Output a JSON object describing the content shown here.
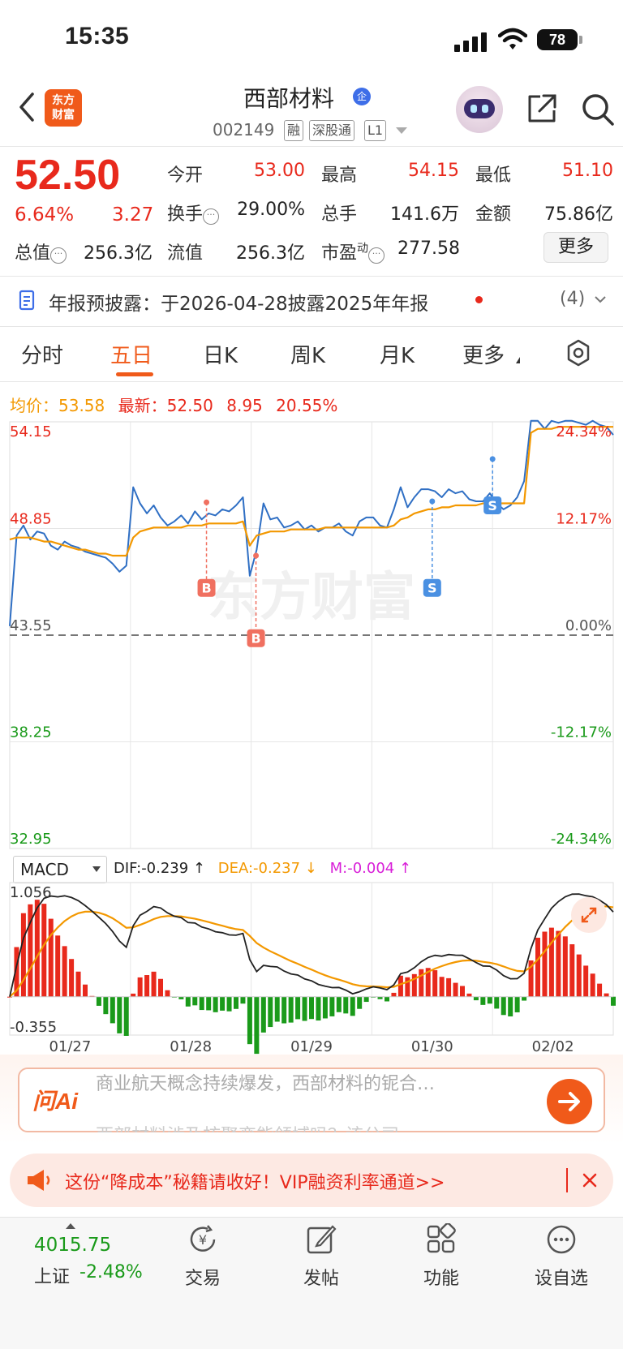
{
  "status_bar": {
    "time": "15:35",
    "battery": "78"
  },
  "header": {
    "logo_line1": "东方",
    "logo_line2": "财富",
    "stock_name": "西部材料",
    "qiye_badge": "企",
    "stock_code": "002149",
    "tags": [
      "融",
      "深股通",
      "L1"
    ]
  },
  "quote": {
    "price": "52.50",
    "pct_change": "6.64%",
    "amt_change": "3.27",
    "fields": [
      {
        "label": "今开",
        "value": "53.00",
        "color": "#e8291c"
      },
      {
        "label": "最高",
        "value": "54.15",
        "color": "#e8291c"
      },
      {
        "label": "最低",
        "value": "51.10",
        "color": "#e8291c"
      },
      {
        "label": "换手",
        "value": "29.00%",
        "color": "#222222"
      },
      {
        "label": "总手",
        "value": "141.6万",
        "color": "#222222"
      },
      {
        "label": "金额",
        "value": "75.86亿",
        "color": "#222222"
      },
      {
        "label": "总值",
        "value": "256.3亿",
        "color": "#222222"
      },
      {
        "label": "流值",
        "value": "256.3亿",
        "color": "#222222"
      },
      {
        "label": "市盈",
        "value": "277.58",
        "color": "#222222"
      }
    ],
    "pe_superscript": "动",
    "more_label": "更多"
  },
  "notice": {
    "text": "年报预披露：于2026-04-28披露2025年年报",
    "count": "(4)"
  },
  "tabs": [
    "分时",
    "五日",
    "日K",
    "周K",
    "月K",
    "更多"
  ],
  "active_tab": "五日",
  "chart_header": {
    "avg_label": "均价：",
    "avg_value": "53.58",
    "latest_label": "最新：",
    "latest_value": "52.50",
    "change": "8.95",
    "change_pct": "20.55%"
  },
  "chart_data": {
    "type": "line",
    "dates": [
      "01/27",
      "01/28",
      "01/29",
      "01/30",
      "02/02"
    ],
    "y_left_ticks": [
      "54.15",
      "48.85",
      "43.55",
      "38.25",
      "32.95"
    ],
    "y_right_ticks": [
      "24.34%",
      "12.17%",
      "0.00%",
      "-12.17%",
      "-24.34%"
    ],
    "ylim": [
      32.95,
      54.15
    ],
    "prev_close": 43.55,
    "watermark": "东方财富",
    "series": [
      {
        "color": "#2f6fc4",
        "values": [
          44.0,
          48.5,
          49.0,
          48.3,
          48.7,
          48.6,
          48.0,
          47.8,
          48.2,
          48.0,
          47.9,
          47.7,
          47.6,
          47.5,
          47.4,
          47.1,
          46.7,
          47.0,
          50.9,
          50.1,
          49.6,
          50.0,
          49.4,
          49.0,
          49.2,
          49.5,
          49.1,
          49.7,
          49.3,
          49.6,
          49.5,
          49.8,
          49.7,
          50.0,
          50.4,
          46.5,
          47.8,
          50.1,
          49.3,
          49.4,
          48.9,
          49.0,
          49.2,
          48.8,
          49.0,
          48.7,
          48.9,
          48.9,
          49.1,
          48.7,
          48.5,
          49.2,
          49.4,
          49.4,
          49.0,
          48.9,
          49.8,
          50.9,
          49.9,
          50.4,
          50.8,
          50.8,
          50.7,
          50.4,
          50.8,
          50.6,
          50.7,
          50.3,
          50.2,
          50.2,
          50.6,
          50.1,
          49.8,
          50.0,
          50.4,
          51.2,
          54.2,
          54.2,
          53.8,
          54.2,
          54.1,
          54.2,
          54.2,
          54.1,
          54.0,
          54.2,
          54.0,
          53.9,
          53.5
        ],
        "name": ""
      },
      {
        "color": "#f39800",
        "values": [
          48.3,
          48.4,
          48.4,
          48.4,
          48.3,
          48.2,
          48.2,
          48.1,
          48.0,
          47.9,
          47.8,
          47.8,
          47.7,
          47.6,
          47.6,
          47.5,
          47.5,
          47.5,
          48.4,
          48.7,
          48.8,
          48.9,
          48.9,
          48.9,
          48.9,
          48.9,
          49.0,
          49.0,
          49.0,
          49.1,
          49.1,
          49.1,
          49.1,
          49.1,
          49.2,
          48.0,
          48.5,
          48.6,
          48.7,
          48.7,
          48.7,
          48.8,
          48.8,
          48.8,
          48.8,
          48.8,
          48.9,
          48.9,
          48.9,
          48.9,
          48.9,
          48.9,
          48.9,
          48.9,
          48.9,
          48.9,
          49.0,
          49.3,
          49.4,
          49.6,
          49.7,
          49.8,
          49.8,
          49.9,
          49.9,
          50.0,
          50.0,
          50.0,
          50.0,
          50.1,
          50.1,
          50.1,
          50.1,
          50.1,
          50.1,
          50.1,
          53.6,
          53.8,
          53.8,
          53.8,
          53.9,
          53.9,
          53.9,
          53.9,
          53.9,
          53.9,
          53.9,
          53.9,
          53.9
        ],
        "name": ""
      }
    ],
    "markers": [
      {
        "type": "B",
        "price": 50.15,
        "at_date_index": 1.63,
        "label_price": 45.9
      },
      {
        "type": "B",
        "price": 47.5,
        "at_date_index": 2.04,
        "label_price": 43.4
      },
      {
        "type": "S",
        "price": 50.2,
        "at_date_index": 3.5,
        "label_price": 45.9
      },
      {
        "type": "S",
        "price": 52.3,
        "at_date_index": 4.0,
        "label_price": 50.0
      }
    ]
  },
  "macd": {
    "selector_label": "MACD",
    "dif": "DIF:-0.239 ↑",
    "dea": "DEA:-0.237 ↓",
    "m": "M:-0.004 ↑",
    "top_tick": "1.056",
    "bottom_tick": "-0.355",
    "ylim": [
      -0.355,
      1.056
    ]
  },
  "ai_banner": {
    "logo": "问Ai",
    "line1": "商业航天概念持续爆发，西部材料的铌合…",
    "line2": "西部材料涉及核聚变能领域吗？该公司"
  },
  "promo": {
    "text": "这份“降成本”秘籍请收好！VIP融资利率通道>>"
  },
  "bottom_nav": {
    "index_value": "4015.75",
    "index_name": "上证",
    "index_pct": "-2.48%",
    "items": [
      "交易",
      "发帖",
      "功能",
      "设自选"
    ]
  }
}
